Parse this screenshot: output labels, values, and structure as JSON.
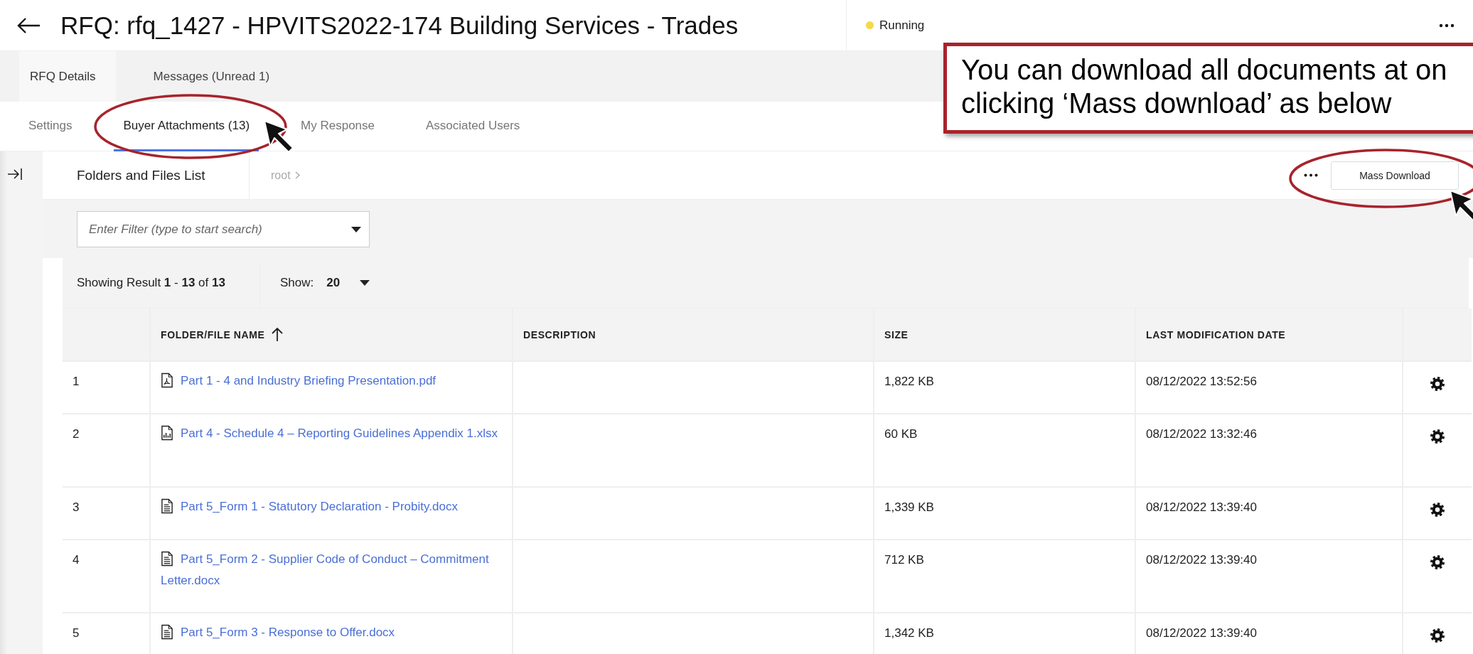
{
  "header": {
    "title": "RFQ: rfq_1427 - HPVITS2022-174 Building Services - Trades",
    "status": "Running"
  },
  "primary_tabs": [
    {
      "label": "RFQ Details",
      "selected": true
    },
    {
      "label": "Messages (Unread 1)",
      "selected": false
    }
  ],
  "secondary_tabs": [
    {
      "label": "Settings",
      "selected": false
    },
    {
      "label": "Buyer Attachments (13)",
      "selected": true
    },
    {
      "label": "My Response",
      "selected": false
    },
    {
      "label": "Associated Users",
      "selected": false
    }
  ],
  "folder_bar": {
    "title": "Folders and Files List",
    "breadcrumb": "root",
    "action": "Mass Download"
  },
  "filter": {
    "placeholder": "Enter Filter (type to start search)"
  },
  "results": {
    "summary": "Showing Result **1** - **13** of **13**",
    "show_label": "Show:",
    "show_value": "20"
  },
  "table": {
    "columns": [
      "FOLDER/FILE NAME",
      "DESCRIPTION",
      "SIZE",
      "LAST MODIFICATION DATE"
    ],
    "rows": [
      {
        "number": "1",
        "kind": "pdf",
        "name": "Part 1 - 4 and Industry Briefing Presentation.pdf",
        "size": "1,822 KB",
        "modified": "08/12/2022 13:52:56"
      },
      {
        "number": "2",
        "kind": "sheet",
        "name": "Part 4 - Schedule 4 – Reporting Guidelines Appendix 1.xlsx",
        "size": "60 KB",
        "modified": "08/12/2022 13:32:46"
      },
      {
        "number": "3",
        "kind": "doc",
        "name": "Part 5_Form 1 - Statutory Declaration - Probity.docx",
        "size": "1,339 KB",
        "modified": "08/12/2022 13:39:40"
      },
      {
        "number": "4",
        "kind": "doc",
        "name": "Part 5_Form 2 - Supplier Code of Conduct – Commitment Letter.docx",
        "size": "712 KB",
        "modified": "08/12/2022 13:39:40"
      },
      {
        "number": "5",
        "kind": "doc",
        "name": "Part 5_Form 3 - Response to Offer.docx",
        "size": "1,342 KB",
        "modified": "08/12/2022 13:39:40"
      }
    ]
  },
  "callout": {
    "lines": [
      "You can download all documents at on",
      "clicking ‘Mass download’ as below"
    ]
  }
}
